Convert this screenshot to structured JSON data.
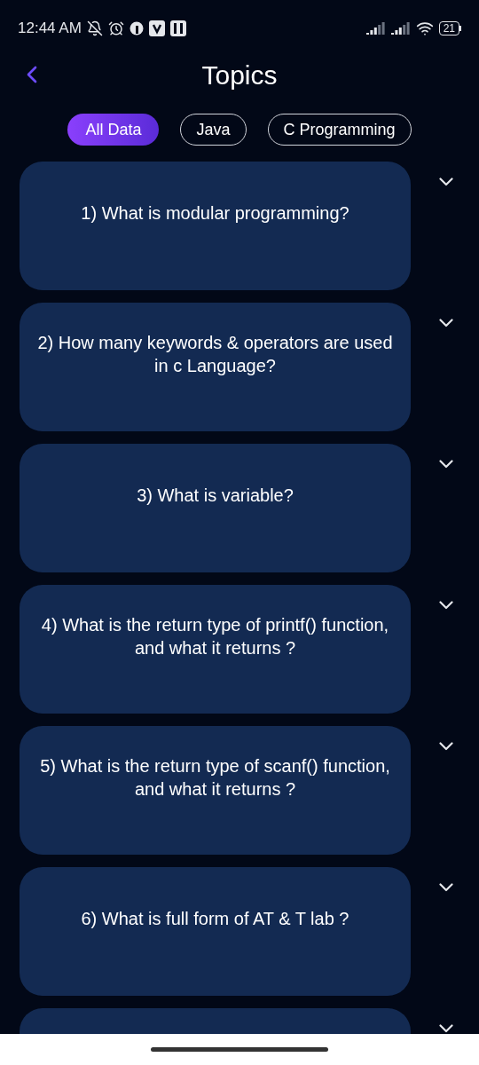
{
  "status_bar": {
    "time": "12:44 AM",
    "battery": "21"
  },
  "header": {
    "title": "Topics"
  },
  "tabs": [
    {
      "label": "All Data",
      "selected": true
    },
    {
      "label": "Java",
      "selected": false
    },
    {
      "label": "C Programming",
      "selected": false
    }
  ],
  "questions": [
    {
      "text": "1) What is modular programming?",
      "expanded": false
    },
    {
      "text": "2) How many keywords & operators are used in c Language?",
      "expanded": false
    },
    {
      "text": "3) What is variable?",
      "expanded": false
    },
    {
      "text": "4) What is the return type of printf() function, and what it returns ?",
      "expanded": false
    },
    {
      "text": "5) What is the return type of scanf() function, and what it returns ?",
      "expanded": false
    },
    {
      "text": "6) What is full form of AT & T lab ?",
      "expanded": false
    },
    {
      "expanded": false
    }
  ]
}
